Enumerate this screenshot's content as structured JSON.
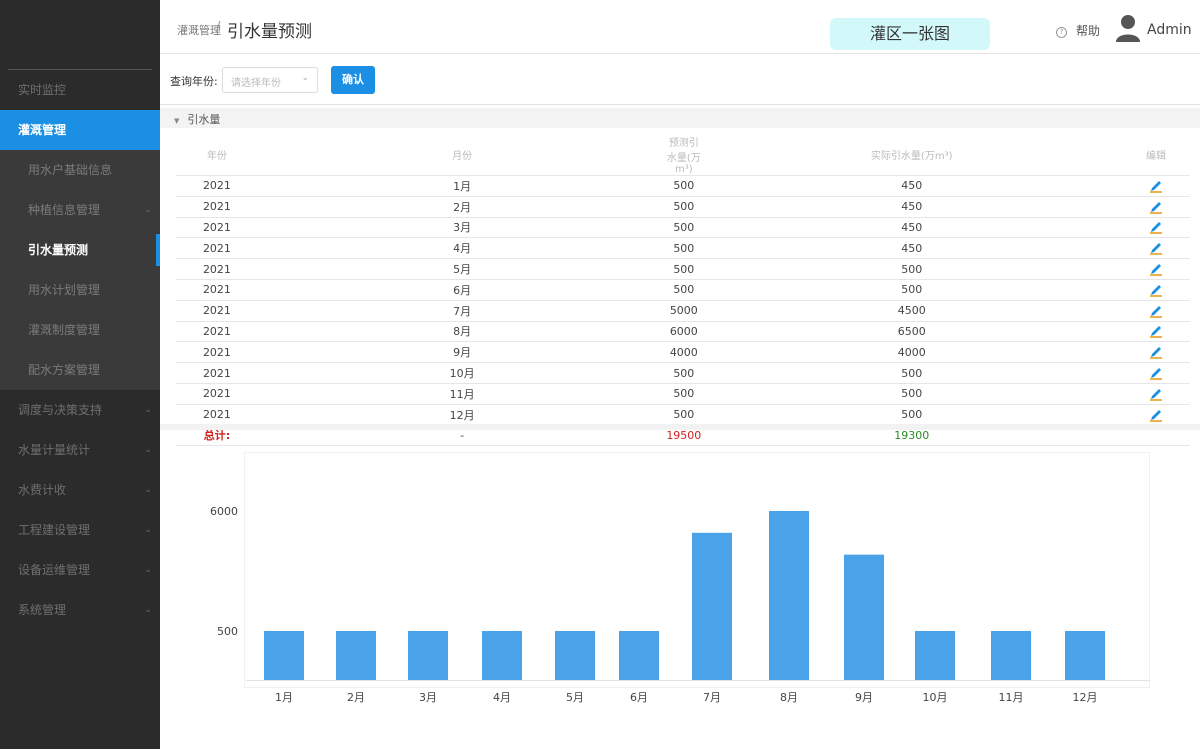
{
  "sidebar": {
    "items": [
      {
        "label": "实时监控",
        "has_arrow": false
      },
      {
        "label": "灌溉管理",
        "active": true
      },
      {
        "label": "调度与决策支持",
        "has_arrow": true
      },
      {
        "label": "水量计量统计",
        "has_arrow": true
      },
      {
        "label": "水费计收",
        "has_arrow": true
      },
      {
        "label": "工程建设管理",
        "has_arrow": true
      },
      {
        "label": "设备运维管理",
        "has_arrow": true
      },
      {
        "label": "系统管理",
        "has_arrow": true
      }
    ],
    "sub_items": [
      {
        "label": "用水户基础信息"
      },
      {
        "label": "种植信息管理",
        "has_arrow": true
      },
      {
        "label": "引水量预测",
        "current": true
      },
      {
        "label": "用水计划管理"
      },
      {
        "label": "灌溉制度管理"
      },
      {
        "label": "配水方案管理"
      }
    ],
    "chevron": "⌄"
  },
  "header": {
    "breadcrumb_parent": "灌溉管理",
    "separator": "/",
    "title": "引水量预测",
    "map_button": "灌区一张图",
    "help_label": "帮助",
    "user_name": "Admin"
  },
  "query": {
    "label": "查询年份:",
    "placeholder": "请选择年份",
    "confirm_label": "确认"
  },
  "panel": {
    "title": "引水量"
  },
  "table": {
    "columns": [
      "年份",
      "月份",
      "预测引水量(万m³)",
      "实际引水量(万m³)",
      "编辑"
    ],
    "rows": [
      [
        "2021",
        "1月",
        "500",
        "450"
      ],
      [
        "2021",
        "2月",
        "500",
        "450"
      ],
      [
        "2021",
        "3月",
        "500",
        "450"
      ],
      [
        "2021",
        "4月",
        "500",
        "450"
      ],
      [
        "2021",
        "5月",
        "500",
        "500"
      ],
      [
        "2021",
        "6月",
        "500",
        "500"
      ],
      [
        "2021",
        "7月",
        "5000",
        "4500"
      ],
      [
        "2021",
        "8月",
        "6000",
        "6500"
      ],
      [
        "2021",
        "9月",
        "4000",
        "4000"
      ],
      [
        "2021",
        "10月",
        "500",
        "500"
      ],
      [
        "2021",
        "11月",
        "500",
        "500"
      ],
      [
        "2021",
        "12月",
        "500",
        "500"
      ]
    ],
    "total": {
      "label": "总计:",
      "month": "-",
      "predicted": "19500",
      "actual": "19300"
    }
  },
  "colors": {
    "accent": "#1a8fe3",
    "bar": "#4aa3e8",
    "total_red": "#d02020",
    "total_green": "#2a8a2a"
  },
  "chart_data": {
    "type": "bar",
    "categories": [
      "1月",
      "2月",
      "3月",
      "4月",
      "5月",
      "6月",
      "7月",
      "8月",
      "9月",
      "10月",
      "11月",
      "12月"
    ],
    "values": [
      500,
      500,
      500,
      500,
      500,
      500,
      5000,
      6000,
      4000,
      500,
      500,
      500
    ],
    "yticks": [
      500,
      6000
    ],
    "title": "",
    "xlabel": "",
    "ylabel": "",
    "grid": false
  }
}
